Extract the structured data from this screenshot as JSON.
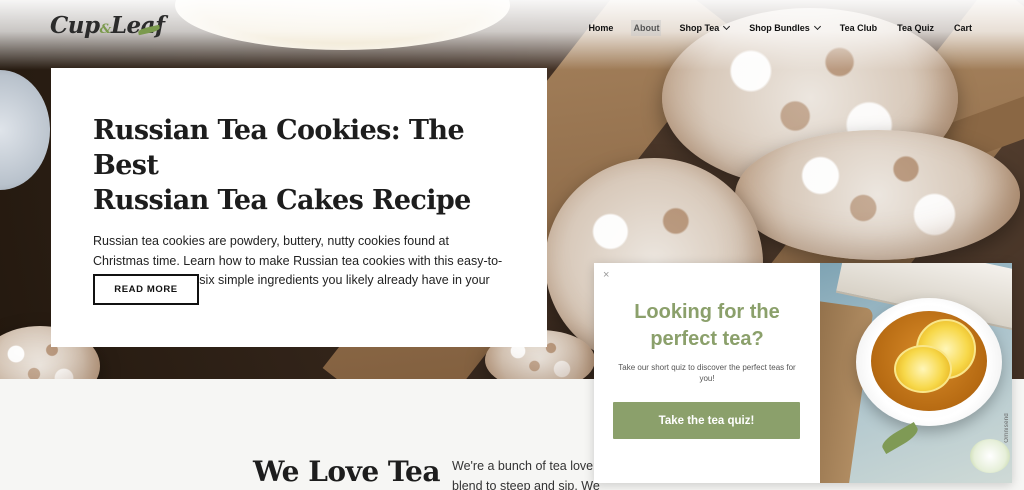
{
  "brand": {
    "name_left": "Cup",
    "name_amp": "&",
    "name_right": "Leaf"
  },
  "nav": {
    "items": [
      {
        "label": "Home",
        "dropdown": false,
        "active": false
      },
      {
        "label": "About",
        "dropdown": false,
        "active": true
      },
      {
        "label": "Shop Tea",
        "dropdown": true,
        "active": false
      },
      {
        "label": "Shop Bundles",
        "dropdown": true,
        "active": false
      },
      {
        "label": "Tea Club",
        "dropdown": false,
        "active": false
      },
      {
        "label": "Tea Quiz",
        "dropdown": false,
        "active": false
      },
      {
        "label": "Cart",
        "dropdown": false,
        "active": false
      }
    ]
  },
  "hero": {
    "title_line1": "Russian Tea Cookies: The Best",
    "title_line2": "Russian Tea Cakes Recipe",
    "description": "Russian tea cookies are powdery, buttery, nutty cookies found at Christmas time. Learn how to make Russian tea cookies with this easy-to-follow recipe using six simple ingredients you likely already have in your kitchen.",
    "button_label": "READ MORE"
  },
  "section": {
    "title": "We Love Tea",
    "text": "We're a bunch of tea lovers always looking for a new tea or blend to steep and sip. We"
  },
  "popup": {
    "close_label": "×",
    "title": "Looking for the perfect tea?",
    "subtitle": "Take our short quiz to discover the perfect teas for you!",
    "button_label": "Take the tea quiz!",
    "watermark": "Omnisend"
  },
  "colors": {
    "accent": "#8ba06b",
    "text": "#1d1d1d",
    "logo_leaf": "#7b9a4d"
  }
}
